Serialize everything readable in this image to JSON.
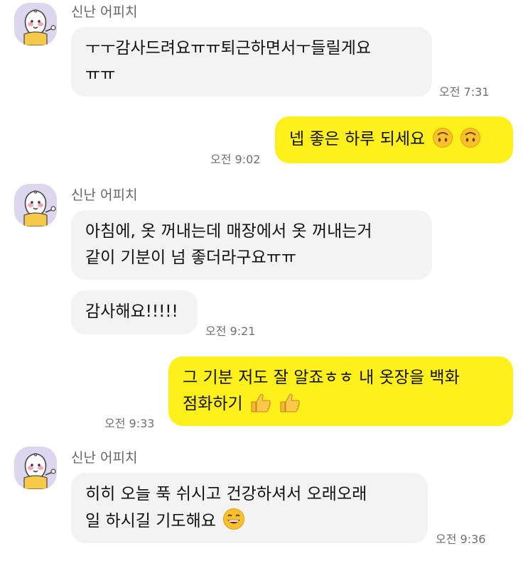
{
  "chat": {
    "sender": "신난 어피치",
    "m1": {
      "line1": "ㅜㅜ감사드려요ㅠㅠ퇴근하면서ㅜ들릴게요",
      "line2": "ㅠㅠ",
      "time": "오전 7:31"
    },
    "m2": {
      "text": "넵 좋은 하루 되세요",
      "time": "오전 9:02",
      "emoji": "upside-down-face"
    },
    "m3": {
      "line1": "아침에, 옷 꺼내는데 매장에서 옷 꺼내는거",
      "line2": "같이 기분이 넘 좋더라구요ㅠㅠ"
    },
    "m4": {
      "text": "감사해요!!!!!",
      "time": "오전 9:21"
    },
    "m5": {
      "line1": "그 기분 저도 잘 알죠ㅎㅎ 내 옷장을 백화",
      "line2": "점화하기",
      "time": "오전 9:33",
      "emoji": "thumbs-up"
    },
    "m6": {
      "line1": "히히 오늘 푹 쉬시고 건강하셔서 오래오래",
      "line2": "일 하시길 기도해요",
      "time": "오전 9:36",
      "emoji": "grinning-face"
    }
  },
  "colors": {
    "incoming_bubble": "#f3f3f3",
    "outgoing_bubble": "#fef01b",
    "avatar_bg": "#ddd6ef"
  }
}
